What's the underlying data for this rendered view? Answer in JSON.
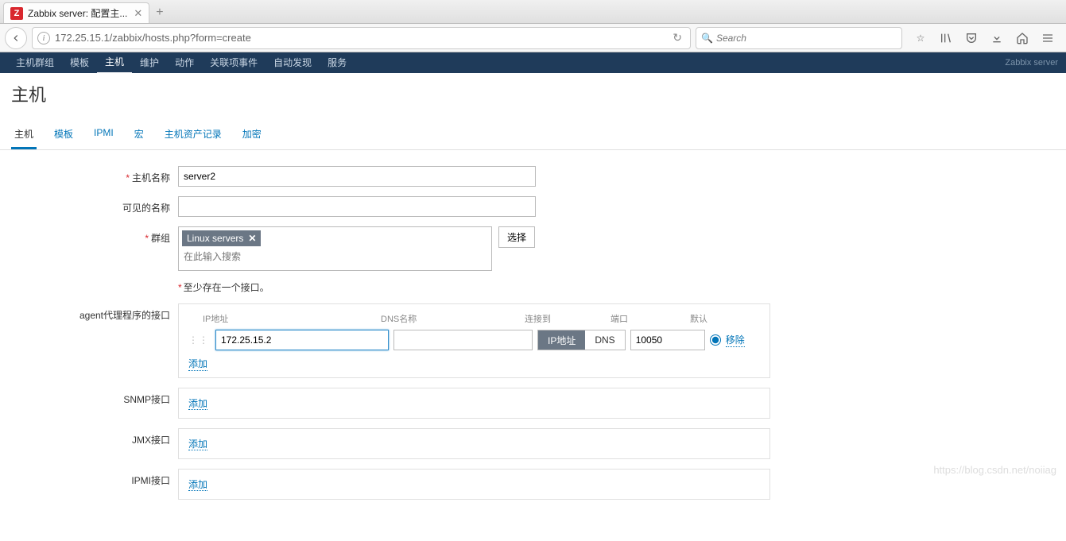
{
  "browser": {
    "tab_title": "Zabbix server: 配置主...",
    "favicon_letter": "Z",
    "url": "172.25.15.1/zabbix/hosts.php?form=create",
    "search_placeholder": "Search"
  },
  "nav": {
    "items": [
      "主机群组",
      "模板",
      "主机",
      "维护",
      "动作",
      "关联项事件",
      "自动发现",
      "服务"
    ],
    "active_index": 2,
    "brand": "Zabbix server"
  },
  "page_title": "主机",
  "subtabs": {
    "items": [
      "主机",
      "模板",
      "IPMI",
      "宏",
      "主机资产记录",
      "加密"
    ],
    "active_index": 0
  },
  "form": {
    "labels": {
      "hostname": "主机名称",
      "visible_name": "可见的名称",
      "groups": "群组",
      "select_button": "选择",
      "group_search_placeholder": "在此输入搜索",
      "interface_hint": "至少存在一个接口。",
      "agent_if": "agent代理程序的接口",
      "snmp_if": "SNMP接口",
      "jmx_if": "JMX接口",
      "ipmi_if": "IPMI接口",
      "add_link": "添加",
      "remove_link": "移除"
    },
    "values": {
      "hostname": "server2",
      "visible_name": "",
      "group_tag": "Linux servers"
    },
    "iface_headers": {
      "ip": "IP地址",
      "dns": "DNS名称",
      "connect": "连接到",
      "port": "端口",
      "default": "默认"
    },
    "agent": {
      "ip": "172.25.15.2",
      "dns": "",
      "connect_ip_label": "IP地址",
      "connect_dns_label": "DNS",
      "port": "10050"
    }
  },
  "watermark": "https://blog.csdn.net/noiiag"
}
